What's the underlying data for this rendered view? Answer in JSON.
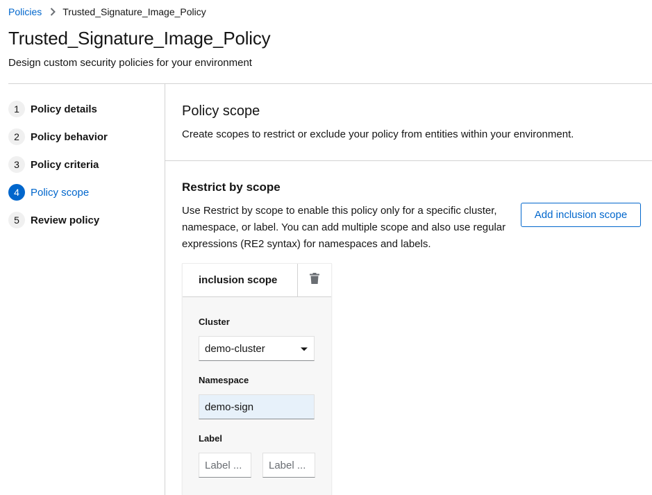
{
  "breadcrumb": {
    "parent": "Policies",
    "current": "Trusted_Signature_Image_Policy"
  },
  "page": {
    "title": "Trusted_Signature_Image_Policy",
    "subtitle": "Design custom security policies for your environment"
  },
  "wizard": {
    "steps": [
      {
        "num": "1",
        "label": "Policy details"
      },
      {
        "num": "2",
        "label": "Policy behavior"
      },
      {
        "num": "3",
        "label": "Policy criteria"
      },
      {
        "num": "4",
        "label": "Policy scope",
        "active": true
      },
      {
        "num": "5",
        "label": "Review policy"
      }
    ]
  },
  "scope_section": {
    "title": "Policy scope",
    "description": "Create scopes to restrict or exclude your policy from entities within your environment."
  },
  "restrict": {
    "title": "Restrict by scope",
    "description": "Use Restrict by scope to enable this policy only for a specific cluster, namespace, or label. You can add multiple scope and also use regular expressions (RE2 syntax) for namespaces and labels.",
    "add_button": "Add inclusion scope"
  },
  "inclusion_scope": {
    "title": "inclusion scope",
    "cluster_label": "Cluster",
    "cluster_value": "demo-cluster",
    "namespace_label": "Namespace",
    "namespace_value": "demo-sign",
    "label_label": "Label",
    "label_key_placeholder": "Label ...",
    "label_value_placeholder": "Label ..."
  },
  "colors": {
    "accent": "#0066cc",
    "divider": "#d2d2d2",
    "filled_input": "#e7f1fa"
  },
  "icons": {
    "breadcrumb_separator": "chevron-right-icon",
    "delete": "trash-icon",
    "dropdown": "caret-down-icon"
  }
}
